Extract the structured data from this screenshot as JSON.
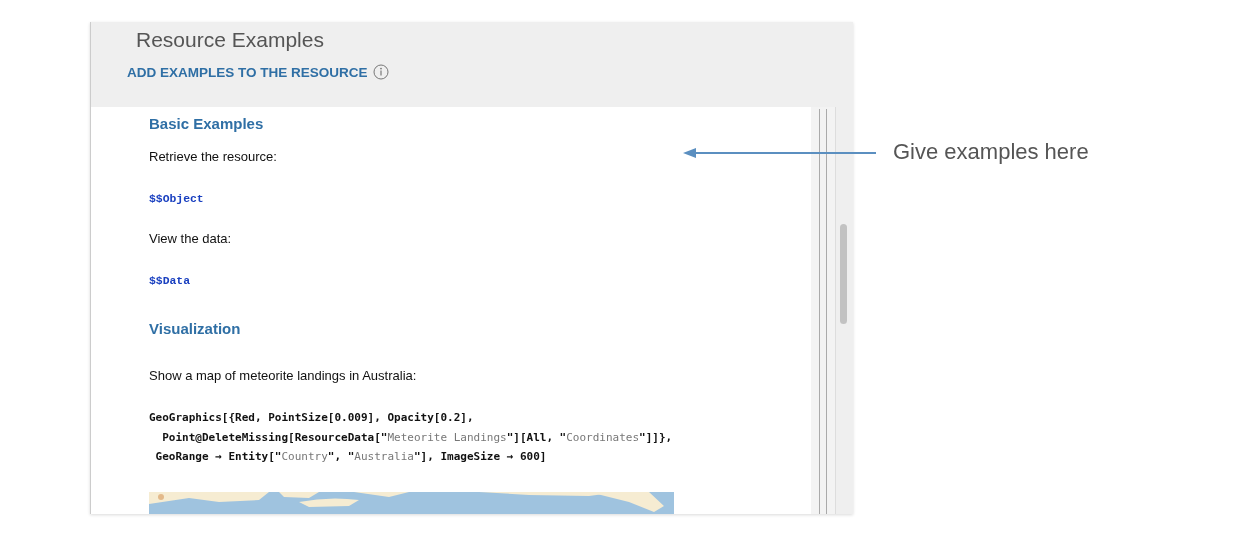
{
  "panel": {
    "title": "Resource Examples",
    "action": "ADD EXAMPLES TO THE RESOURCE",
    "sections": [
      {
        "heading": "Basic Examples",
        "cells": [
          {
            "kind": "text",
            "text": "Retrieve the resource:"
          },
          {
            "kind": "input",
            "text": "$$Object"
          },
          {
            "kind": "text",
            "text": "View the data:"
          },
          {
            "kind": "input",
            "text": "$$Data"
          }
        ]
      },
      {
        "heading": "Visualization",
        "cells": [
          {
            "kind": "text",
            "text": "Show a map of meteorite landings in Australia:"
          },
          {
            "kind": "code",
            "lines": [
              [
                {
                  "kind": "symbol",
                  "text": "GeoGraphics[{Red, PointSize[0.009], Opacity[0.2],"
                }
              ],
              [
                {
                  "kind": "symbol",
                  "text": "  Point@DeleteMissing[ResourceData[\""
                },
                {
                  "kind": "string",
                  "text": "Meteorite Landings"
                },
                {
                  "kind": "symbol",
                  "text": "\"][All, \""
                },
                {
                  "kind": "string",
                  "text": "Coordinates"
                },
                {
                  "kind": "symbol",
                  "text": "\"]]},"
                }
              ],
              [
                {
                  "kind": "symbol",
                  "text": " GeoRange → Entity[\""
                },
                {
                  "kind": "string",
                  "text": "Country"
                },
                {
                  "kind": "symbol",
                  "text": "\", \""
                },
                {
                  "kind": "string",
                  "text": "Australia"
                },
                {
                  "kind": "symbol",
                  "text": "\"], ImageSize → 600]"
                }
              ]
            ]
          },
          {
            "kind": "picture"
          }
        ]
      }
    ]
  },
  "annotation": {
    "text": "Give examples here"
  }
}
